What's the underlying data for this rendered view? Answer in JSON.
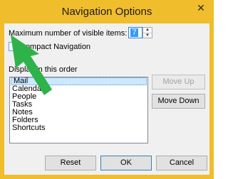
{
  "window": {
    "title": "Navigation Options",
    "close_glyph": "✕"
  },
  "max_items": {
    "label": "Maximum number of visible items:",
    "value": "7"
  },
  "compact": {
    "label": "Compact Navigation",
    "checked": false
  },
  "order": {
    "label": "Display in this order",
    "items": [
      "Mail",
      "Calendar",
      "People",
      "Tasks",
      "Notes",
      "Folders",
      "Shortcuts"
    ],
    "selected_index": 0
  },
  "buttons": {
    "move_up": "Move Up",
    "move_down": "Move Down",
    "reset": "Reset",
    "ok": "OK",
    "cancel": "Cancel"
  },
  "colors": {
    "accent": "#f0bd2c",
    "pointer_arrow": "#2db34a"
  }
}
